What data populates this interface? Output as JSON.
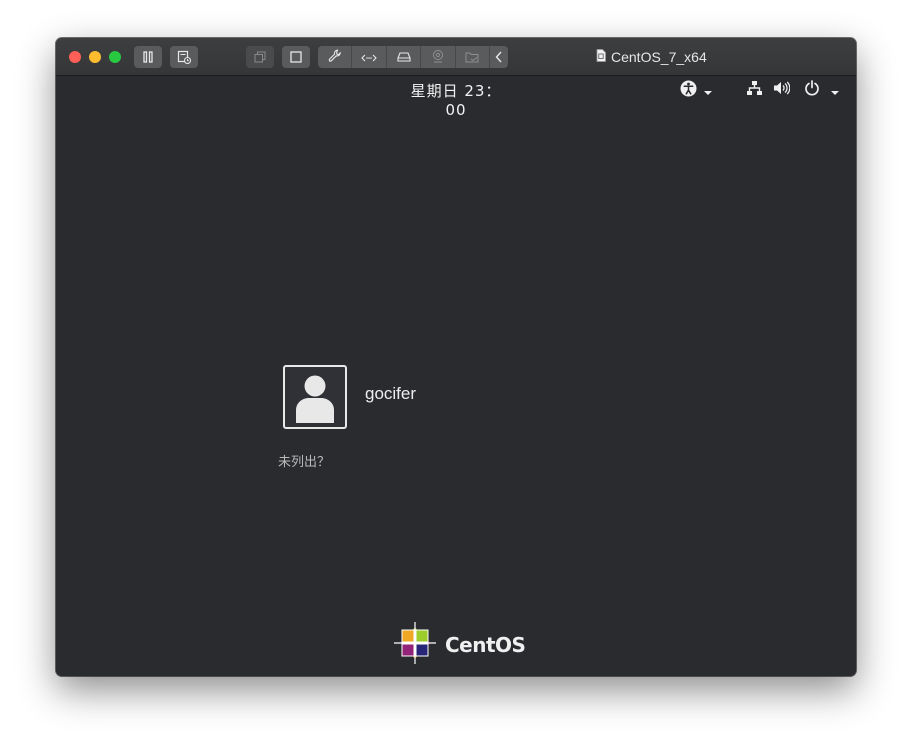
{
  "window": {
    "title": "CentOS_7_x64"
  },
  "toolbar": {
    "icons": [
      "pause-icon",
      "snapshot-icon",
      "fullscreen-icon",
      "window-icon",
      "settings-wrench-icon",
      "network-arrows-icon",
      "hard-disk-icon",
      "camera-icon",
      "shared-folder-icon",
      "collapse-chevron-icon"
    ]
  },
  "topbar": {
    "clock": "星期日 23：00",
    "icons": [
      "accessibility-icon",
      "network-icon",
      "volume-icon",
      "power-icon"
    ]
  },
  "login": {
    "username": "gocifer",
    "not_listed": "未列出？"
  },
  "brand": {
    "name": "CentOS"
  },
  "colors": {
    "screen_bg": "#292b2f",
    "titlebar_bg": "#3a3b3d",
    "close": "#fe5f57",
    "minimize": "#febc2e",
    "zoom": "#28c840"
  }
}
